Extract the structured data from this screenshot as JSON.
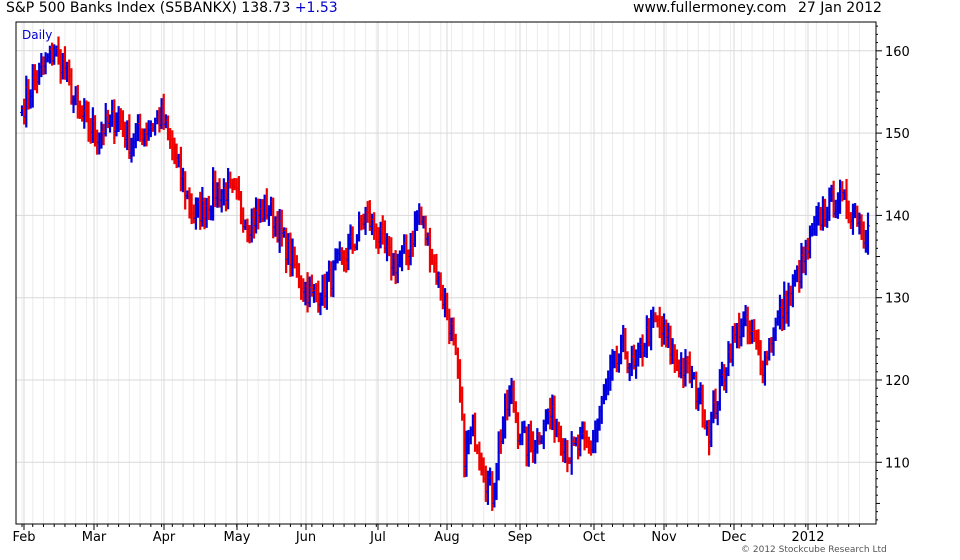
{
  "header": {
    "title": "S&P 500 Banks Index (S5BANKX) 138.73",
    "change": "+1.53",
    "site": "www.fullermoney.com",
    "date": "27 Jan 2012"
  },
  "footer": {
    "copyright": "© 2012 Stockcube Research Ltd"
  },
  "colors": {
    "up": "#0000dd",
    "down": "#ee0000",
    "grid": "#d9d9d9",
    "axis": "#000000"
  },
  "chart_data": {
    "type": "ohlc",
    "period_label": "Daily",
    "y_axis": {
      "min": 102.5,
      "max": 163.5,
      "ticks": [
        110,
        120,
        130,
        140,
        150,
        160
      ],
      "side": "right"
    },
    "x_axis": {
      "months": [
        "Feb",
        "Mar",
        "Apr",
        "May",
        "Jun",
        "Jul",
        "Aug",
        "Sep",
        "Oct",
        "Nov",
        "Dec",
        "2012"
      ]
    },
    "grid": true,
    "keypoints": [
      [
        0,
        153
      ],
      [
        5,
        156
      ],
      [
        10,
        158
      ],
      [
        15,
        160
      ],
      [
        20,
        158
      ],
      [
        25,
        153
      ],
      [
        30,
        151
      ],
      [
        35,
        150
      ],
      [
        40,
        151
      ],
      [
        45,
        152
      ],
      [
        50,
        149
      ],
      [
        55,
        150
      ],
      [
        60,
        151
      ],
      [
        65,
        152
      ],
      [
        70,
        148
      ],
      [
        75,
        144
      ],
      [
        80,
        140
      ],
      [
        85,
        141
      ],
      [
        90,
        143
      ],
      [
        95,
        143
      ],
      [
        100,
        142
      ],
      [
        105,
        139
      ],
      [
        110,
        140
      ],
      [
        115,
        141
      ],
      [
        120,
        138
      ],
      [
        125,
        135
      ],
      [
        130,
        132
      ],
      [
        135,
        130
      ],
      [
        140,
        131
      ],
      [
        145,
        133
      ],
      [
        150,
        135
      ],
      [
        155,
        137
      ],
      [
        160,
        140
      ],
      [
        165,
        138
      ],
      [
        170,
        135
      ],
      [
        175,
        134
      ],
      [
        180,
        136
      ],
      [
        185,
        140
      ],
      [
        190,
        136
      ],
      [
        195,
        131
      ],
      [
        200,
        126
      ],
      [
        203,
        120
      ],
      [
        206,
        111
      ],
      [
        210,
        114
      ],
      [
        213,
        112
      ],
      [
        216,
        108
      ],
      [
        219,
        106
      ],
      [
        222,
        112
      ],
      [
        225,
        116
      ],
      [
        228,
        118
      ],
      [
        231,
        114
      ],
      [
        235,
        112
      ],
      [
        240,
        113
      ],
      [
        245,
        116
      ],
      [
        250,
        114
      ],
      [
        255,
        111
      ],
      [
        260,
        112
      ],
      [
        265,
        112
      ],
      [
        270,
        117
      ],
      [
        275,
        121
      ],
      [
        280,
        124
      ],
      [
        285,
        121
      ],
      [
        290,
        125
      ],
      [
        295,
        127
      ],
      [
        300,
        125
      ],
      [
        305,
        122
      ],
      [
        310,
        121
      ],
      [
        315,
        118
      ],
      [
        320,
        114
      ],
      [
        325,
        119
      ],
      [
        330,
        124
      ],
      [
        335,
        127
      ],
      [
        340,
        125
      ],
      [
        345,
        122
      ],
      [
        350,
        126
      ],
      [
        355,
        129
      ],
      [
        360,
        132
      ],
      [
        365,
        135
      ],
      [
        370,
        139
      ],
      [
        375,
        141
      ],
      [
        380,
        142
      ],
      [
        385,
        141
      ],
      [
        390,
        140
      ],
      [
        392,
        137.5
      ],
      [
        394,
        138.73
      ]
    ]
  }
}
